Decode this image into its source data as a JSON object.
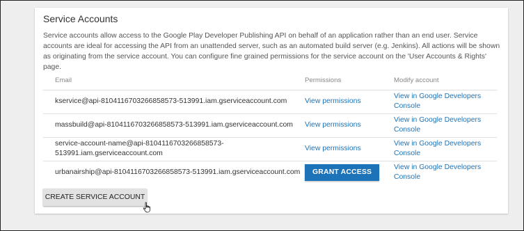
{
  "section": {
    "title": "Service Accounts",
    "description": "Service accounts allow access to the Google Play Developer Publishing API on behalf of an application rather than an end user. Service accounts are ideal for accessing the API from an unattended server, such as an automated build server (e.g. Jenkins). All actions will be shown as originating from the service account. You can configure fine grained permissions for the service account on the 'User Accounts & Rights' page."
  },
  "table": {
    "headers": {
      "email": "Email",
      "permissions": "Permissions",
      "modify": "Modify account"
    },
    "rows": [
      {
        "email": "kservice@api-8104116703266858573-513991.iam.gserviceaccount.com",
        "permission": "View permissions",
        "modify": "View in Google Developers Console"
      },
      {
        "email": "massbuild@api-8104116703266858573-513991.iam.gserviceaccount.com",
        "permission": "View permissions",
        "modify": "View in Google Developers Console"
      },
      {
        "email": "service-account-name@api-8104116703266858573-513991.iam.gserviceaccount.com",
        "permission": "View permissions",
        "modify": "View in Google Developers Console"
      },
      {
        "email": "urbanairship@api-8104116703266858573-513991.iam.gserviceaccount.com",
        "permission": "GRANT ACCESS",
        "modify": "View in Google Developers Console"
      }
    ]
  },
  "buttons": {
    "create": "CREATE SERVICE ACCOUNT"
  },
  "colors": {
    "link": "#1c73b8",
    "primary_button": "#1c73b8",
    "secondary_button": "#e2e2e2"
  },
  "icons": {
    "cursor": "hand-pointer-icon"
  }
}
